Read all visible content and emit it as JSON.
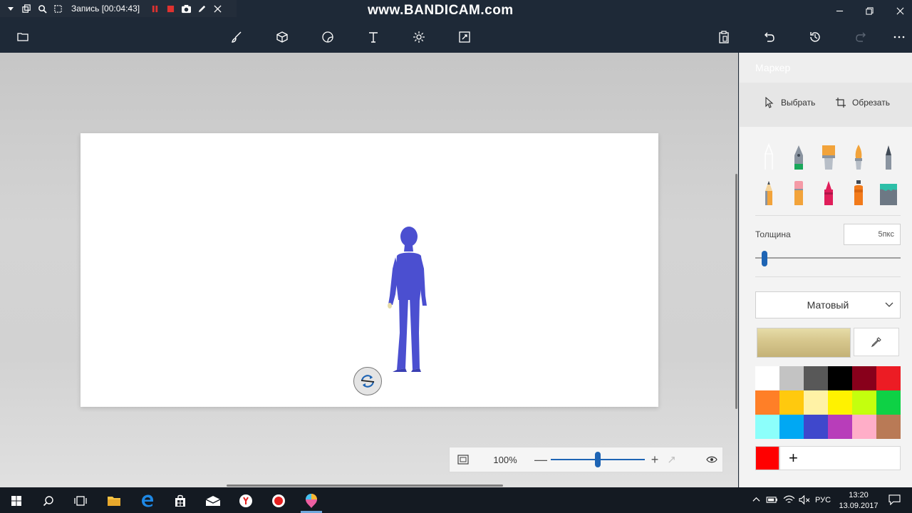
{
  "recorder": {
    "label": "Запись [00:04:43]",
    "watermark": "www.BANDICAM.com"
  },
  "toolbar": {
    "left_icons": [
      "menu-icon"
    ],
    "tools": [
      "brush-icon",
      "3d-shapes-icon",
      "stickers-icon",
      "text-icon",
      "effects-icon",
      "canvas-icon"
    ],
    "right_icons": [
      "paste-icon",
      "undo-icon",
      "history-icon",
      "redo-icon",
      "more-icon"
    ]
  },
  "panel": {
    "title": "Маркер",
    "select_label": "Выбрать",
    "crop_label": "Обрезать",
    "tools": [
      "calligraphy-pen-icon",
      "pen-icon",
      "oil-brush-icon",
      "watercolor-icon",
      "pixel-pen-icon",
      "pencil-icon",
      "eraser-icon",
      "crayon-icon",
      "spray-can-icon",
      "fill-bucket-icon"
    ],
    "thickness_label": "Толщина",
    "thickness_value": "5пкс",
    "thickness_level": 0.04,
    "finish": "Матовый",
    "current_color": "#d6c68c",
    "palette": [
      "#ffffff",
      "#c3c3c3",
      "#585858",
      "#000000",
      "#88001b",
      "#ec1c24",
      "#ff7f27",
      "#ffc90e",
      "#fff2a5",
      "#fff200",
      "#c4ff0e",
      "#0ed145",
      "#8cfffb",
      "#00a8f3",
      "#3f48cc",
      "#b83dba",
      "#ffaec8",
      "#b97a56"
    ],
    "custom_color": "#ff0000",
    "add_label": "+"
  },
  "zoom": {
    "value": "100%",
    "minus": "—",
    "plus": "+",
    "level": 0.5
  },
  "taskbar": {
    "language": "РУС",
    "time": "13:20",
    "date": "13.09.2017"
  }
}
